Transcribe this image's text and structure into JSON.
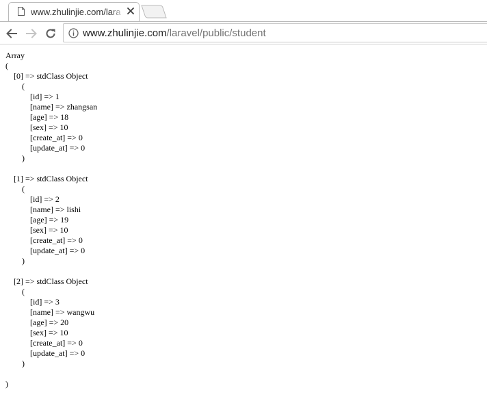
{
  "tab": {
    "title": "www.zhulinjie.com/lara",
    "favicon": "page-icon",
    "close_icon": "close-icon"
  },
  "toolbar": {
    "back_icon": "back-arrow-icon",
    "forward_icon": "forward-arrow-icon",
    "reload_icon": "reload-icon",
    "info_icon": "info-icon",
    "url_host": "www.zhulinjie.com",
    "url_path": "/laravel/public/student"
  },
  "page": {
    "dump": "Array\n(\n    [0] => stdClass Object\n        (\n            [id] => 1\n            [name] => zhangsan\n            [age] => 18\n            [sex] => 10\n            [create_at] => 0\n            [update_at] => 0\n        )\n\n    [1] => stdClass Object\n        (\n            [id] => 2\n            [name] => lishi\n            [age] => 19\n            [sex] => 10\n            [create_at] => 0\n            [update_at] => 0\n        )\n\n    [2] => stdClass Object\n        (\n            [id] => 3\n            [name] => wangwu\n            [age] => 20\n            [sex] => 10\n            [create_at] => 0\n            [update_at] => 0\n        )\n\n)"
  },
  "colors": {
    "tab_border": "#b9b9b9",
    "icon_active": "#5a5a5a",
    "icon_disabled": "#c4c4c4",
    "url_host": "#222222",
    "url_path": "#737373"
  }
}
